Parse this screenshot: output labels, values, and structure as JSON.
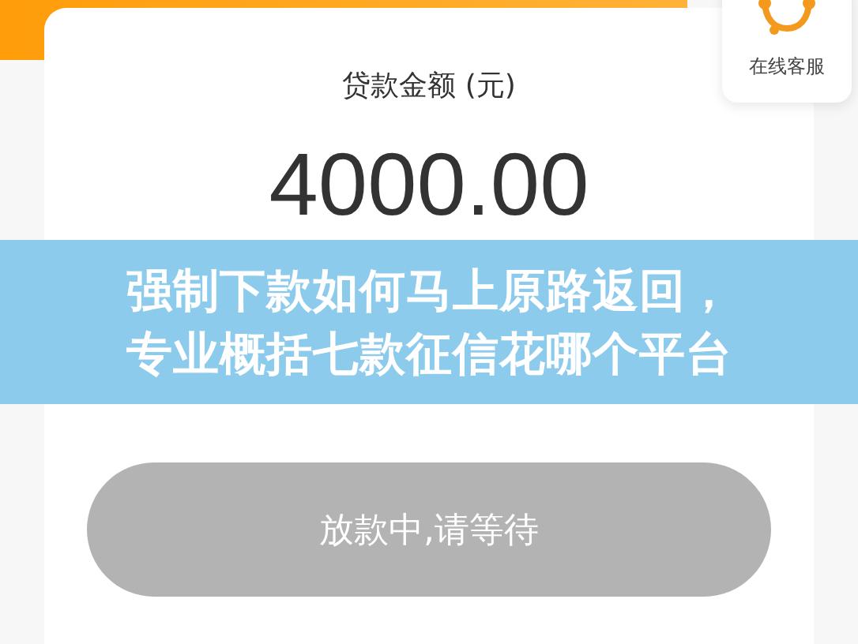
{
  "customer_service": {
    "label": "在线客服"
  },
  "loan": {
    "label": "贷款金额 (元)",
    "amount": "4000.00"
  },
  "submit_button": {
    "label": "放款中,请等待",
    "disabled": true
  },
  "banner": {
    "lines": [
      "强制下款如何马上原路返回，",
      "专业概括七款征信花哪个平台"
    ]
  }
}
